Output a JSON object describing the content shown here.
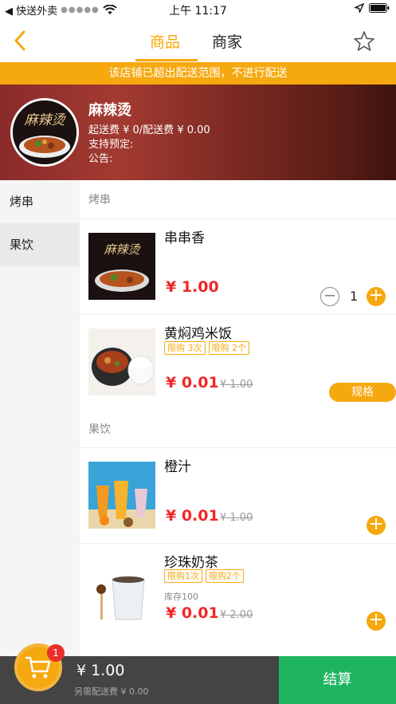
{
  "status_bar": {
    "app_back": "◀ 快送外卖",
    "time": "上午 11:17"
  },
  "nav": {
    "tab_goods": "商品",
    "tab_shop": "商家"
  },
  "notice": "该店铺已超出配送范围，不进行配送",
  "shop": {
    "name": "麻辣烫",
    "fee_line": "起送费 ¥ 0/配送费 ¥ 0.00",
    "preorder_line": "支持预定:",
    "announcement_line": "公告:",
    "logo_text": "麻辣烫"
  },
  "sidebar": {
    "items": [
      {
        "label": "烤串",
        "active": false
      },
      {
        "label": "果饮",
        "active": true
      }
    ]
  },
  "sections": {
    "kaochuan": "烤串",
    "guoyin": "果饮"
  },
  "products": [
    {
      "name": "串串香",
      "price": "¥ 1.00",
      "old_price": "",
      "qty": "1",
      "tags": [],
      "stock": ""
    },
    {
      "name": "黄焖鸡米饭",
      "price": "¥ 0.01",
      "old_price": "¥ 1.00",
      "tags": [
        "限购 3次",
        "限购 2个"
      ],
      "spec": "规格",
      "stock": ""
    },
    {
      "name": "橙汁",
      "price": "¥ 0.01",
      "old_price": "¥ 1.00",
      "tags": [],
      "stock": ""
    },
    {
      "name": "珍珠奶茶",
      "price": "¥ 0.01",
      "old_price": "¥ 2.00",
      "tags": [
        "限购1次",
        "限购2个"
      ],
      "stock": "库存100"
    }
  ],
  "cart": {
    "badge": "1",
    "total": "¥ 1.00",
    "fee": "另需配送费 ¥ 0.00",
    "checkout": "结算"
  },
  "colors": {
    "accent": "#f6a80f",
    "price": "#f02828",
    "checkout": "#1fb560",
    "cart_bar": "#444444"
  },
  "icons": [
    "back-chevron-icon",
    "star-outline-icon",
    "wifi-icon",
    "location-arrow-icon",
    "battery-icon",
    "cart-icon",
    "plus-icon",
    "minus-icon"
  ]
}
